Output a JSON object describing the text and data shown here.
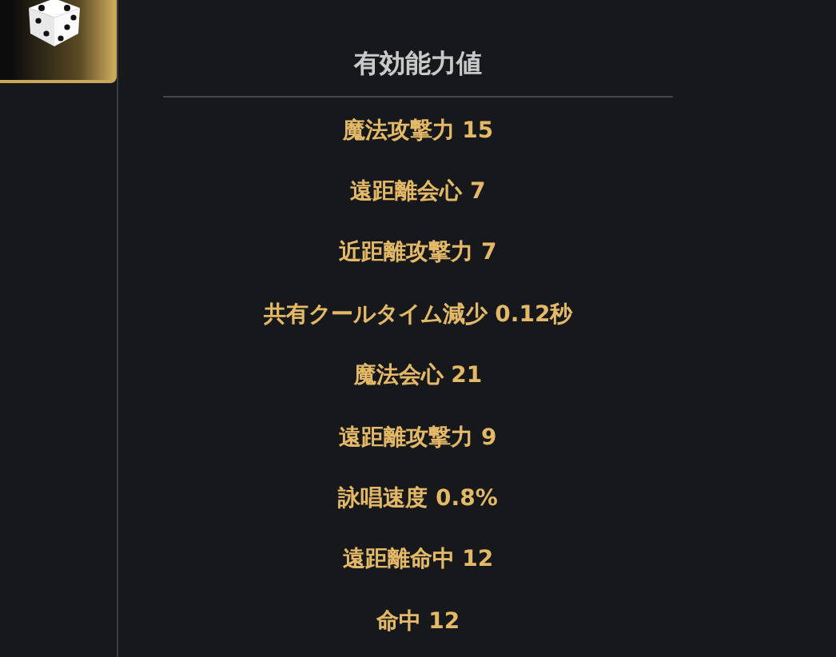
{
  "panel": {
    "title": "有効能力値",
    "stats": [
      "魔法攻撃力 15",
      "遠距離会心 7",
      "近距離攻撃力 7",
      "共有クールタイム減少 0.12秒",
      "魔法会心 21",
      "遠距離攻撃力 9",
      "詠唱速度 0.8%",
      "遠距離命中 12",
      "命中 12"
    ]
  }
}
